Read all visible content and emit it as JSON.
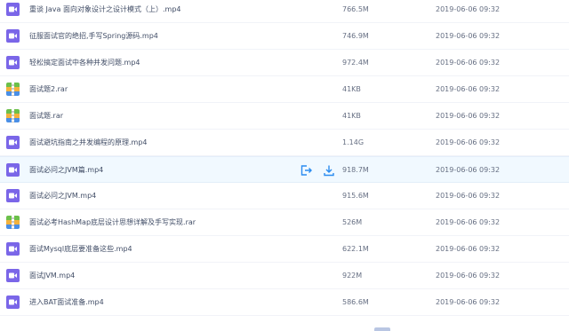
{
  "files": [
    {
      "name": "重谈 Java 面向对象设计之设计模式（上）.mp4",
      "size": "766.5M",
      "date": "2019-06-06 09:32",
      "type": "video",
      "icon": "video-file-icon"
    },
    {
      "name": "征服面试官的绝招,手写Spring源码.mp4",
      "size": "746.9M",
      "date": "2019-06-06 09:32",
      "type": "video",
      "icon": "video-file-icon"
    },
    {
      "name": "轻松搞定面试中各种并发问题.mp4",
      "size": "972.4M",
      "date": "2019-06-06 09:32",
      "type": "video",
      "icon": "video-file-icon"
    },
    {
      "name": "面试题2.rar",
      "size": "41KB",
      "date": "2019-06-06 09:32",
      "type": "archive",
      "icon": "archive-file-icon"
    },
    {
      "name": "面试题.rar",
      "size": "41KB",
      "date": "2019-06-06 09:32",
      "type": "archive",
      "icon": "archive-file-icon"
    },
    {
      "name": "面试避坑指南之并发编程的原理.mp4",
      "size": "1.14G",
      "date": "2019-06-06 09:32",
      "type": "video",
      "icon": "video-file-icon"
    },
    {
      "name": "面试必问之JVM篇.mp4",
      "size": "918.7M",
      "date": "2019-06-06 09:32",
      "type": "video",
      "icon": "video-file-icon",
      "highlighted": true
    },
    {
      "name": "面试必问之JVM.mp4",
      "size": "915.6M",
      "date": "2019-06-06 09:32",
      "type": "video",
      "icon": "video-file-icon"
    },
    {
      "name": "面试必考HashMap底层设计思想详解及手写实现.rar",
      "size": "526M",
      "date": "2019-06-06 09:32",
      "type": "archive",
      "icon": "archive-file-icon"
    },
    {
      "name": "面试Mysql底层要准备这些.mp4",
      "size": "622.1M",
      "date": "2019-06-06 09:32",
      "type": "video",
      "icon": "video-file-icon"
    },
    {
      "name": "面试JVM.mp4",
      "size": "922M",
      "date": "2019-06-06 09:32",
      "type": "video",
      "icon": "video-file-icon"
    },
    {
      "name": "进入BAT面试准备.mp4",
      "size": "586.6M",
      "date": "2019-06-06 09:32",
      "type": "video",
      "icon": "video-file-icon"
    }
  ],
  "row_actions": {
    "share_icon": "share-icon",
    "download_icon": "download-icon"
  },
  "colors": {
    "accent": "#2b8cf0",
    "video_icon": "#7a66e8",
    "highlight_row": "#f1f9ff",
    "text": "#424e67",
    "muted_text": "#666f83"
  }
}
